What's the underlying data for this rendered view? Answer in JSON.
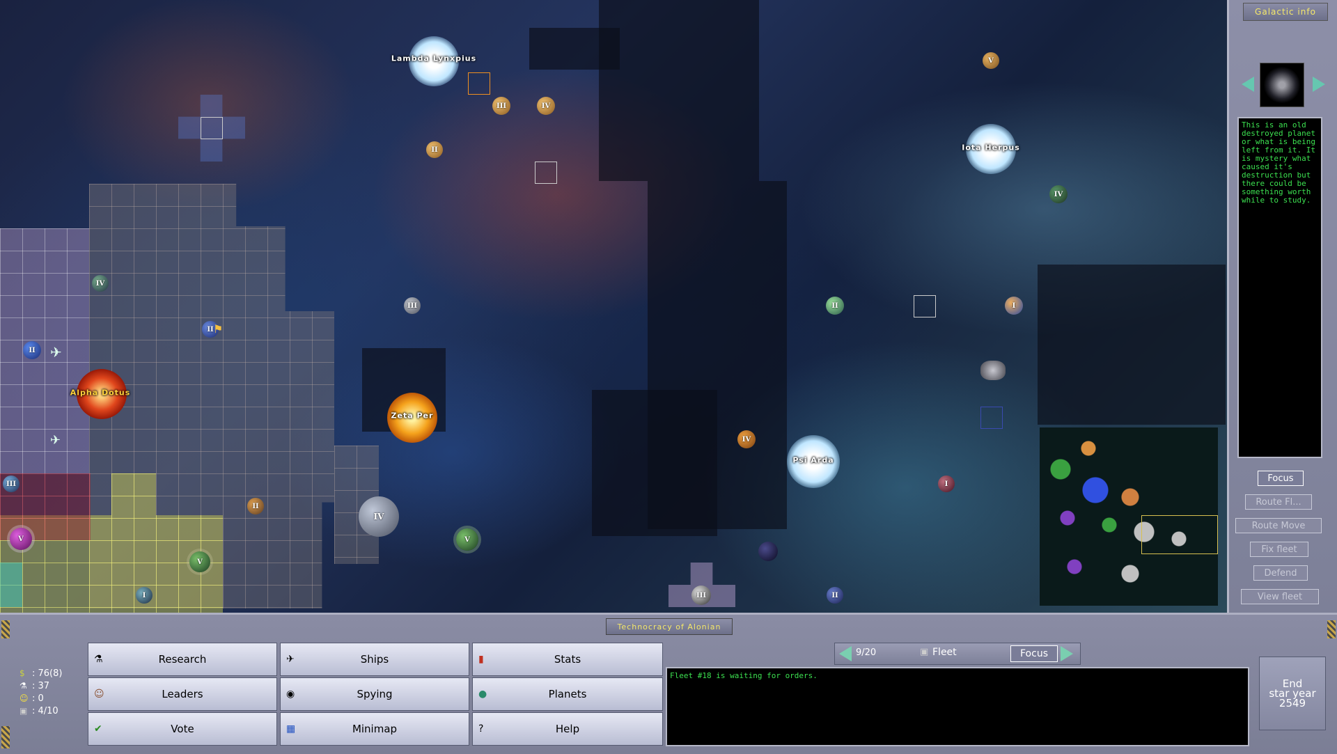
{
  "map": {
    "stars": [
      {
        "name": "Lambda Lynxpius",
        "color": "#bfe6ff"
      },
      {
        "name": "Iota Herpus",
        "color": "#bfe6ff"
      },
      {
        "name": "Alpha Dotus",
        "color": "#e0461c"
      },
      {
        "name": "Zeta Per",
        "color": "#f5a21c"
      },
      {
        "name": "Psi Arda",
        "color": "#bfe6ff"
      }
    ],
    "planets": [
      {
        "label": "V"
      },
      {
        "label": "III"
      },
      {
        "label": "IV"
      },
      {
        "label": "II"
      },
      {
        "label": "IV"
      },
      {
        "label": "IV"
      },
      {
        "label": "II"
      },
      {
        "label": "III"
      },
      {
        "label": "II"
      },
      {
        "label": "I"
      },
      {
        "label": "II"
      },
      {
        "label": "III"
      },
      {
        "label": "II"
      },
      {
        "label": "IV"
      },
      {
        "label": "V"
      },
      {
        "label": "V"
      },
      {
        "label": "I"
      },
      {
        "label": "IV"
      },
      {
        "label": "V"
      },
      {
        "label": "I"
      },
      {
        "label": "III"
      },
      {
        "label": "II"
      },
      {
        "label": ""
      }
    ]
  },
  "galactic_info": {
    "title": "Galactic info",
    "description": "This is an old destroyed planet or what is being left from it. It is mystery what caused it's destruction but there could be something worth while to study.",
    "buttons": [
      "Focus",
      "Route Fl...",
      "Route Move",
      "Fix fleet",
      "Defend",
      "View fleet"
    ]
  },
  "empire": {
    "name": "Technocracy of Alonian"
  },
  "stats": [
    {
      "icon": "credits-icon",
      "value": ": 76(8)"
    },
    {
      "icon": "research-icon",
      "value": ": 37"
    },
    {
      "icon": "happiness-icon",
      "value": ": 0"
    },
    {
      "icon": "fleet-icon",
      "value": ": 4/10"
    }
  ],
  "menu": [
    {
      "label": "Research",
      "icon": "flask-icon",
      "glyph": "⚗"
    },
    {
      "label": "Ships",
      "icon": "ship-icon",
      "glyph": "✈"
    },
    {
      "label": "Stats",
      "icon": "chart-icon",
      "glyph": "▮"
    },
    {
      "label": "Leaders",
      "icon": "leader-icon",
      "glyph": "☺"
    },
    {
      "label": "Spying",
      "icon": "spy-icon",
      "glyph": "◉"
    },
    {
      "label": "Planets",
      "icon": "planet-icon",
      "glyph": "●"
    },
    {
      "label": "Vote",
      "icon": "check-icon",
      "glyph": "✔"
    },
    {
      "label": "Minimap",
      "icon": "minimap-icon",
      "glyph": "▦"
    },
    {
      "label": "Help",
      "icon": "help-icon",
      "glyph": "?"
    }
  ],
  "fleet_bar": {
    "counter": "9/20",
    "label": "Fleet",
    "focus": "Focus"
  },
  "messages": {
    "text": "Fleet #18 is waiting for orders."
  },
  "end_turn": {
    "line1": "End",
    "line2": "star year",
    "line3": "2549"
  }
}
